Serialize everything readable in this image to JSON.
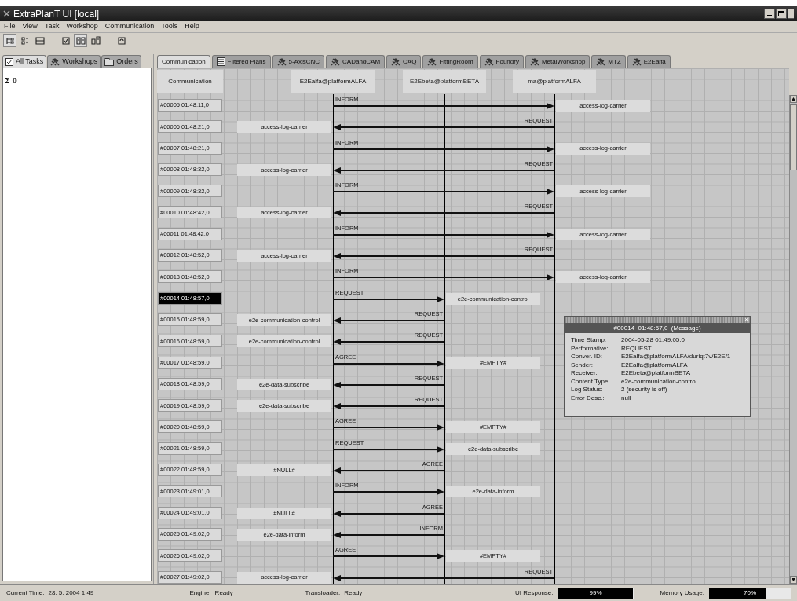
{
  "window": {
    "title": "ExtraPlanT UI [local]"
  },
  "menu": [
    "File",
    "View",
    "Task",
    "Workshop",
    "Communication",
    "Tools",
    "Help"
  ],
  "left_panel": {
    "tabs": [
      {
        "label": "All Tasks",
        "selected": true
      },
      {
        "label": "Workshops",
        "selected": false
      },
      {
        "label": "Orders",
        "selected": false
      }
    ],
    "summary": "Σ 0"
  },
  "main_tabs": [
    {
      "label": "Communication",
      "selected": true
    },
    {
      "label": "Filtered Plans",
      "selected": false
    },
    {
      "label": "5-AxisCNC",
      "selected": false
    },
    {
      "label": "CADandCAM",
      "selected": false
    },
    {
      "label": "CAQ",
      "selected": false
    },
    {
      "label": "FittingRoom",
      "selected": false
    },
    {
      "label": "Foundry",
      "selected": false
    },
    {
      "label": "MetalWorkshop",
      "selected": false
    },
    {
      "label": "MTZ",
      "selected": false
    },
    {
      "label": "E2Ealfa",
      "selected": false
    }
  ],
  "diagram": {
    "corner": "Communication",
    "lifelines": [
      "E2Ealfa@platformALFA",
      "E2Ebeta@platformBETA",
      "ma@platformALFA"
    ],
    "messages": [
      {
        "stamp": "#00005  01:48:11,0",
        "kind": "alfa_to_ma",
        "performative": "INFORM",
        "content": "access-log-carrier",
        "selected": false
      },
      {
        "stamp": "#00006  01:48:21,0",
        "kind": "ma_to_alfa",
        "performative": "REQUEST",
        "content": "access-log-carrier",
        "selected": false
      },
      {
        "stamp": "#00007  01:48:21,0",
        "kind": "alfa_to_ma",
        "performative": "INFORM",
        "content": "access-log-carrier",
        "selected": false
      },
      {
        "stamp": "#00008  01:48:32,0",
        "kind": "ma_to_alfa",
        "performative": "REQUEST",
        "content": "access-log-carrier",
        "selected": false
      },
      {
        "stamp": "#00009  01:48:32,0",
        "kind": "alfa_to_ma",
        "performative": "INFORM",
        "content": "access-log-carrier",
        "selected": false
      },
      {
        "stamp": "#00010  01:48:42,0",
        "kind": "ma_to_alfa",
        "performative": "REQUEST",
        "content": "access-log-carrier",
        "selected": false
      },
      {
        "stamp": "#00011  01:48:42,0",
        "kind": "alfa_to_ma",
        "performative": "INFORM",
        "content": "access-log-carrier",
        "selected": false
      },
      {
        "stamp": "#00012  01:48:52,0",
        "kind": "ma_to_alfa",
        "performative": "REQUEST",
        "content": "access-log-carrier",
        "selected": false
      },
      {
        "stamp": "#00013  01:48:52,0",
        "kind": "alfa_to_ma",
        "performative": "INFORM",
        "content": "access-log-carrier",
        "selected": false
      },
      {
        "stamp": "#00014  01:48:57,0",
        "kind": "alfa_to_beta",
        "performative": "REQUEST",
        "content": "e2e-communication-control",
        "selected": true
      },
      {
        "stamp": "#00015  01:48:59,0",
        "kind": "beta_to_alfa",
        "performative": "REQUEST",
        "content": "e2e-communication-control",
        "selected": false
      },
      {
        "stamp": "#00016  01:48:59,0",
        "kind": "beta_to_alfa",
        "performative": "REQUEST",
        "content": "e2e-communication-control",
        "selected": false
      },
      {
        "stamp": "#00017  01:48:59,0",
        "kind": "alfa_to_beta",
        "performative": "AGREE",
        "content": "#EMPTY#",
        "selected": false
      },
      {
        "stamp": "#00018  01:48:59,0",
        "kind": "beta_to_alfa",
        "performative": "REQUEST",
        "content": "e2e-data-subscribe",
        "selected": false
      },
      {
        "stamp": "#00019  01:48:59,0",
        "kind": "beta_to_alfa",
        "performative": "REQUEST",
        "content": "e2e-data-subscribe",
        "selected": false
      },
      {
        "stamp": "#00020  01:48:59,0",
        "kind": "alfa_to_beta",
        "performative": "AGREE",
        "content": "#EMPTY#",
        "selected": false
      },
      {
        "stamp": "#00021  01:48:59,0",
        "kind": "alfa_to_beta",
        "performative": "REQUEST",
        "content": "e2e-data-subscribe",
        "selected": false
      },
      {
        "stamp": "#00022  01:48:59,0",
        "kind": "beta_to_alfa",
        "performative": "AGREE",
        "content": "#NULL#",
        "selected": false
      },
      {
        "stamp": "#00023  01:49:01,0",
        "kind": "alfa_to_beta",
        "performative": "INFORM",
        "content": "e2e-data-inform",
        "selected": false
      },
      {
        "stamp": "#00024  01:49:01,0",
        "kind": "beta_to_alfa",
        "performative": "AGREE",
        "content": "#NULL#",
        "selected": false
      },
      {
        "stamp": "#00025  01:49:02,0",
        "kind": "beta_to_alfa",
        "performative": "INFORM",
        "content": "e2e-data-inform",
        "selected": false
      },
      {
        "stamp": "#00026  01:49:02,0",
        "kind": "alfa_to_beta",
        "performative": "AGREE",
        "content": "#EMPTY#",
        "selected": false
      },
      {
        "stamp": "#00027  01:49:02,0",
        "kind": "ma_to_alfa",
        "performative": "REQUEST",
        "content": "access-log-carrier",
        "selected": false
      }
    ]
  },
  "message_popup": {
    "title": "#00014  01:48:57,0  (Message)",
    "close": "×",
    "fields": [
      {
        "label": "Time Stamp:",
        "value": "2004-05-28 01:49:05.0"
      },
      {
        "label": "Performative:",
        "value": "REQUEST"
      },
      {
        "label": "Conver. ID:",
        "value": "E2Ealfa@platformALFA/duriqt7v/E2E/1"
      },
      {
        "label": "Sender:",
        "value": "E2Ealfa@platformALFA"
      },
      {
        "label": "Receiver:",
        "value": "E2Ebeta@platformBETA"
      },
      {
        "label": "Content Type:",
        "value": "e2e-communication-control"
      },
      {
        "label": "Log Status:",
        "value": "2 (security is off)"
      },
      {
        "label": "Error Desc.:",
        "value": "null"
      }
    ]
  },
  "status_bar": {
    "current_time_label": "Current Time:",
    "current_time": "28. 5. 2004 1:49",
    "engine_label": "Engine:",
    "engine": "Ready",
    "transloader_label": "Transloader:",
    "transloader": "Ready",
    "meters": [
      {
        "label": "UI Response:",
        "reading": "99%",
        "level": 0.99
      },
      {
        "label": "Memory Usage:",
        "reading": "70%",
        "level": 0.7
      }
    ]
  }
}
